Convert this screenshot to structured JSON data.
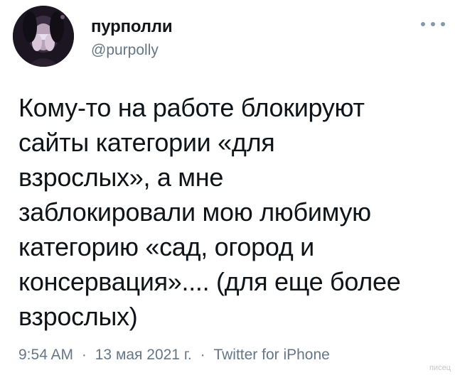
{
  "author": {
    "display_name": "пурполли",
    "handle": "@purpolly",
    "avatar_icon": "avatar-photo"
  },
  "more_icon": "more-dots-icon",
  "tweet": {
    "lines": [
      "Кому-то на работе блокируют",
      "сайты категории «для",
      "взрослых», а мне",
      "заблокировали мою любимую",
      "категорию «сад, огород и",
      "консервация».... (для еще более",
      "взрослых)"
    ]
  },
  "meta": {
    "time": "9:54 AM",
    "date": "13 мая 2021 г.",
    "source": "Twitter for iPhone",
    "separator": "·"
  },
  "watermark": "писец",
  "colors": {
    "text": "#0f1419",
    "secondary": "#657786",
    "background": "#ffffff"
  }
}
